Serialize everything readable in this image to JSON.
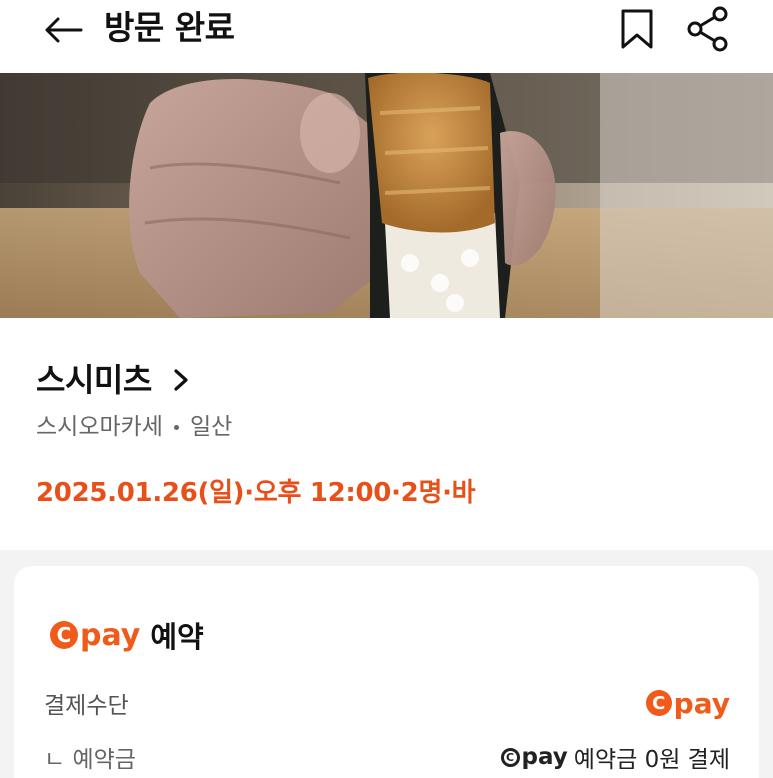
{
  "header": {
    "title": "방문 완료",
    "back_icon": "arrow-left-icon",
    "bookmark_icon": "bookmark-icon",
    "share_icon": "share-icon"
  },
  "hero": {
    "image": "sushi-hand-roll-photo"
  },
  "restaurant": {
    "name": "스시미츠",
    "category": "스시오마카세",
    "location": "일산",
    "reservation": "2025.01.26(일)·오후 12:00·2명·바"
  },
  "payment_card": {
    "brand_c": "C",
    "brand_pay": "pay",
    "title": "예약",
    "method_label": "결제수단",
    "deposit_label": "ㄴ 예약금",
    "deposit_value": "예약금 0원 결제"
  },
  "colors": {
    "accent": "#e8501a",
    "cpay": "#f05a1a",
    "background": "#f3f3f3"
  }
}
